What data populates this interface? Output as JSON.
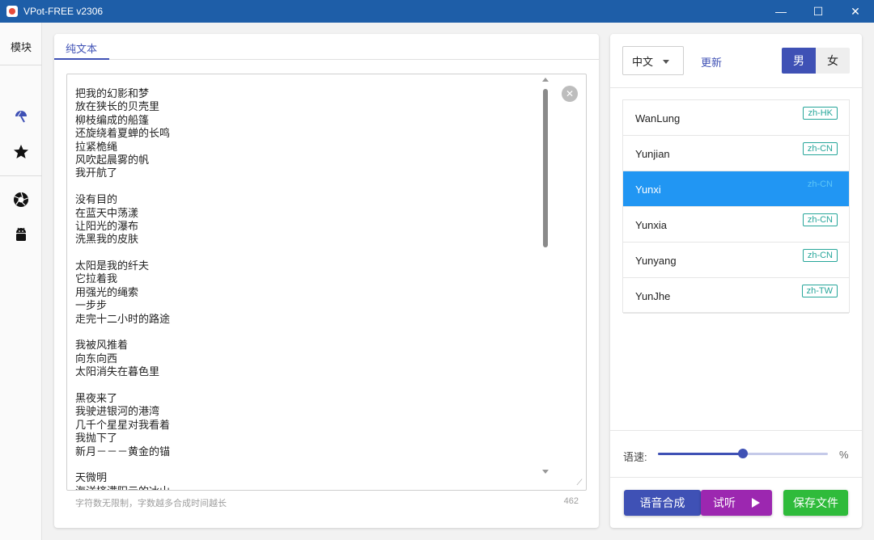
{
  "window": {
    "title": "VPot-FREE v2306",
    "controls": {
      "minimize": "—",
      "maximize": "☐",
      "close": "✕"
    }
  },
  "sidebar": {
    "title": "模块",
    "items": [
      {
        "icon": "umbrella-icon"
      },
      {
        "icon": "star-icon"
      },
      {
        "icon": "aperture-icon"
      },
      {
        "icon": "android-icon"
      }
    ]
  },
  "editor": {
    "tab_label": "纯文本",
    "lines": [
      "把我的幻影和梦",
      "放在狭长的贝壳里",
      "柳枝编成的船篷",
      "还旋绕着夏蝉的长鸣",
      "拉紧桅绳",
      "风吹起晨雾的帆",
      "我开航了",
      "",
      "没有目的",
      "在蓝天中荡漾",
      "让阳光的瀑布",
      "洗黑我的皮肤",
      "",
      "太阳是我的纤夫",
      "它拉着我",
      "用强光的绳索",
      "一步步",
      "走完十二小时的路途",
      "",
      "我被风推着",
      "向东向西",
      "太阳消失在暮色里",
      "",
      "黑夜来了",
      "我驶进银河的港湾",
      "几千个星星对我看着",
      "我抛下了",
      "新月－－－黄金的锚",
      "",
      "天微明",
      "海洋挤满阳云的冰山"
    ],
    "hint": "字符数无限制，字数越多合成时间越长",
    "char_count": "462"
  },
  "voice_panel": {
    "language": "中文",
    "update_label": "更新",
    "gender_male": "男",
    "gender_female": "女",
    "voices": [
      {
        "name": "WanLung",
        "locale": "zh-HK",
        "selected": false
      },
      {
        "name": "Yunjian",
        "locale": "zh-CN",
        "selected": false
      },
      {
        "name": "Yunxi",
        "locale": "zh-CN",
        "selected": true
      },
      {
        "name": "Yunxia",
        "locale": "zh-CN",
        "selected": false
      },
      {
        "name": "Yunyang",
        "locale": "zh-CN",
        "selected": false
      },
      {
        "name": "YunJhe",
        "locale": "zh-TW",
        "selected": false
      }
    ],
    "speed_label": "语速:",
    "speed_value": 0.5,
    "speed_unit": "%"
  },
  "actions": {
    "synthesize": "语音合成",
    "trial": "试听",
    "save": "保存文件"
  },
  "colors": {
    "titlebar": "#1e5ea8",
    "primary": "#3f51b5",
    "selected": "#2196f3",
    "trial": "#9c27b0",
    "save": "#2fbb3b",
    "badge": "#26a69a"
  }
}
